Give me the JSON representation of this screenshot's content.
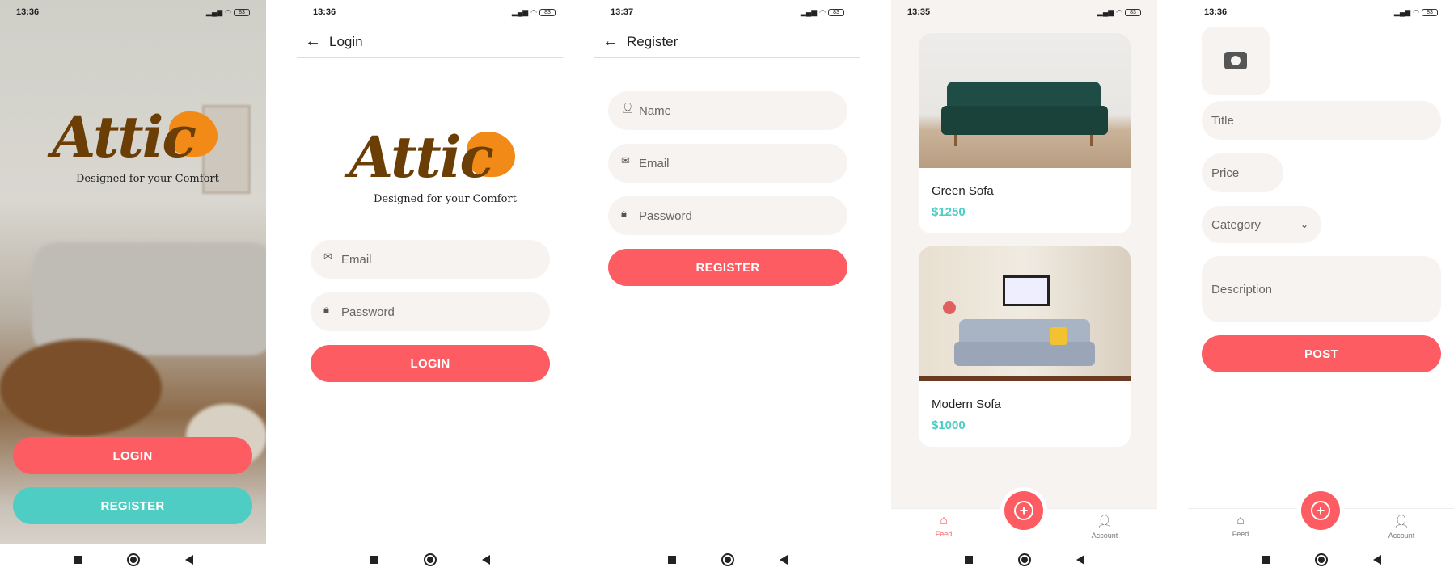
{
  "status": {
    "s1_time": "13:36",
    "s2_time": "13:36",
    "s3_time": "13:37",
    "s4_time": "13:35",
    "s5_time": "13:36",
    "battery": "83",
    "icons": "⏰ ıłı Ⓐ in ⚃ ··"
  },
  "brand": {
    "name": "Attic",
    "tagline": "Designed for your Comfort"
  },
  "welcome": {
    "login_label": "LOGIN",
    "register_label": "REGISTER"
  },
  "login": {
    "title": "Login",
    "email_placeholder": "Email",
    "password_placeholder": "Password",
    "button_label": "LOGIN"
  },
  "register": {
    "title": "Register",
    "name_placeholder": "Name",
    "email_placeholder": "Email",
    "password_placeholder": "Password",
    "button_label": "REGISTER"
  },
  "feed": {
    "listings": [
      {
        "title": "Green Sofa",
        "price": "$1250"
      },
      {
        "title": "Modern Sofa",
        "price": "$1000"
      }
    ],
    "nav": {
      "feed_label": "Feed",
      "account_label": "Account"
    }
  },
  "post": {
    "title_placeholder": "Title",
    "price_placeholder": "Price",
    "category_placeholder": "Category",
    "description_placeholder": "Description",
    "button_label": "POST",
    "nav": {
      "feed_label": "Feed",
      "account_label": "Account"
    }
  },
  "colors": {
    "accent": "#fd5c63",
    "teal": "#4ecdc4",
    "brand_brown": "#6b3e06",
    "brand_orange": "#f28a18"
  },
  "icons": [
    "back-arrow-icon",
    "mail-icon",
    "lock-icon",
    "person-icon",
    "home-icon",
    "account-icon",
    "plus-icon",
    "camera-icon",
    "chevron-down-icon"
  ]
}
